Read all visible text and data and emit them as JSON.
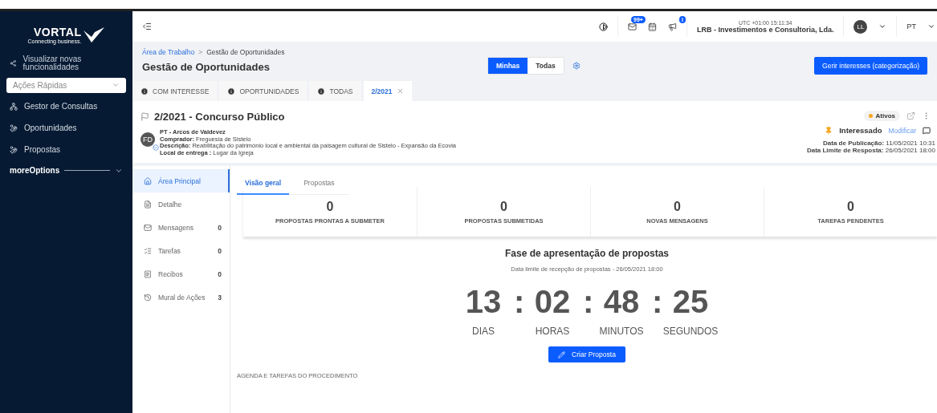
{
  "sidebar": {
    "logo_text": "VORTAL",
    "logo_tagline": "Connecting business.",
    "whats_new": "Visualizar novas funcionalidades",
    "quick_actions": {
      "placeholder": "Ações Rápidas"
    },
    "items": [
      {
        "label": "Gestor de Consultas",
        "kind": "consult"
      },
      {
        "label": "Oportunidades",
        "kind": "bag"
      },
      {
        "label": "Propostas",
        "kind": "bag"
      }
    ],
    "more": "moreOptions"
  },
  "topbar": {
    "messages_badge": "99+",
    "news_badge": "i",
    "clock": "UTC +01:00 15:11:34",
    "company": "LRB - Investimentos e Consultoria, Lda.",
    "avatar": "LL",
    "language": "PT"
  },
  "breadcrumb": [
    {
      "label": "Área de Trabalho",
      "kind": "link"
    },
    {
      "label": "Gestão de Oportunidades",
      "kind": "current"
    }
  ],
  "breadcrumb_separator": ">",
  "page_title": "Gestão de Oportunidades",
  "filter": [
    {
      "label": "Minhas",
      "selected": true
    },
    {
      "label": "Todas",
      "selected": false
    }
  ],
  "manage_button": "Gerir interesses (categorização)",
  "tabs": [
    {
      "label": "COM INTERESSE",
      "kind": "info",
      "selected": false
    },
    {
      "label": "OPORTUNIDADES",
      "kind": "info",
      "selected": false
    },
    {
      "label": "TODAS",
      "kind": "info",
      "selected": false
    },
    {
      "label": "2/2021",
      "kind": "closable",
      "selected": true
    }
  ],
  "procedure": {
    "title": "2/2021 - Concurso Público",
    "status": {
      "label": "Ativos",
      "color": "#f5a623"
    },
    "avatar": "FD",
    "entity": "PT - Arcos de Valdevez",
    "fields": [
      "**Comprador:** Freguesia de Sistelo",
      "**Descrição:** Reabilitação do património local e ambiental da paisagem cultural de Sistelo - Expansão da Ecovia",
      "**Local de entrega :** Lugar da Igreja"
    ],
    "interest": "Interessado",
    "modify": "Modificar",
    "dates": [
      "**Data de Publicação:** 11/05/2021 10:31",
      "**Data Limite de Resposta:** 26/05/2021 18:00"
    ]
  },
  "side_nav": [
    {
      "label": "Área Principal",
      "kind": "home",
      "selected": true
    },
    {
      "label": "Detalhe",
      "kind": "doc",
      "selected": false
    },
    {
      "label": "Mensagens",
      "kind": "mail",
      "count": "0",
      "selected": false
    },
    {
      "label": "Tarefas",
      "kind": "list",
      "count": "0",
      "selected": false
    },
    {
      "label": "Recibos",
      "kind": "receipt",
      "count": "0",
      "selected": false
    },
    {
      "label": "Mural de Ações",
      "kind": "history",
      "count": "3",
      "selected": false
    }
  ],
  "content_tabs": [
    {
      "label": "Visão geral",
      "selected": true
    },
    {
      "label": "Propostas",
      "selected": false
    }
  ],
  "stats": [
    {
      "value": "0",
      "label": "PROPOSTAS PRONTAS A SUBMETER"
    },
    {
      "value": "0",
      "label": "PROPOSTAS SUBMETIDAS"
    },
    {
      "value": "0",
      "label": "NOVAS MENSAGENS"
    },
    {
      "value": "0",
      "label": "TAREFAS PENDENTES"
    }
  ],
  "phase": {
    "title": "Fase de apresentação de propostas",
    "subtitle": "Data limite de recepção de propostas - 26/05/2021 18:00",
    "countdown": [
      {
        "value": "13",
        "unit": "DIAS"
      },
      {
        "value": "02",
        "unit": "HORAS"
      },
      {
        "value": "48",
        "unit": "MINUTOS"
      },
      {
        "value": "25",
        "unit": "SEGUNDOS"
      }
    ],
    "separator": ":",
    "button": "Criar Proposta"
  },
  "agenda_title": "AGENDA E TAREFAS DO PROCEDIMENTO"
}
